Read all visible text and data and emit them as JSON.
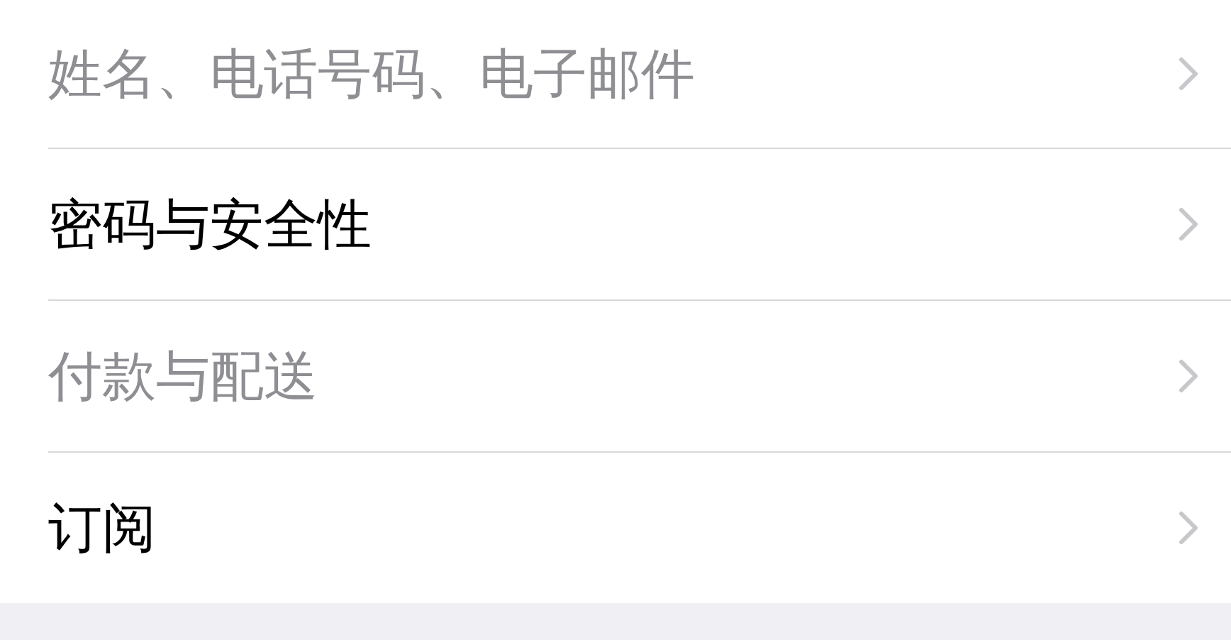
{
  "rows": [
    {
      "label": "姓名、电话号码、电子邮件",
      "disabled": true
    },
    {
      "label": "密码与安全性",
      "disabled": false
    },
    {
      "label": "付款与配送",
      "disabled": true
    },
    {
      "label": "订阅",
      "disabled": false
    }
  ]
}
